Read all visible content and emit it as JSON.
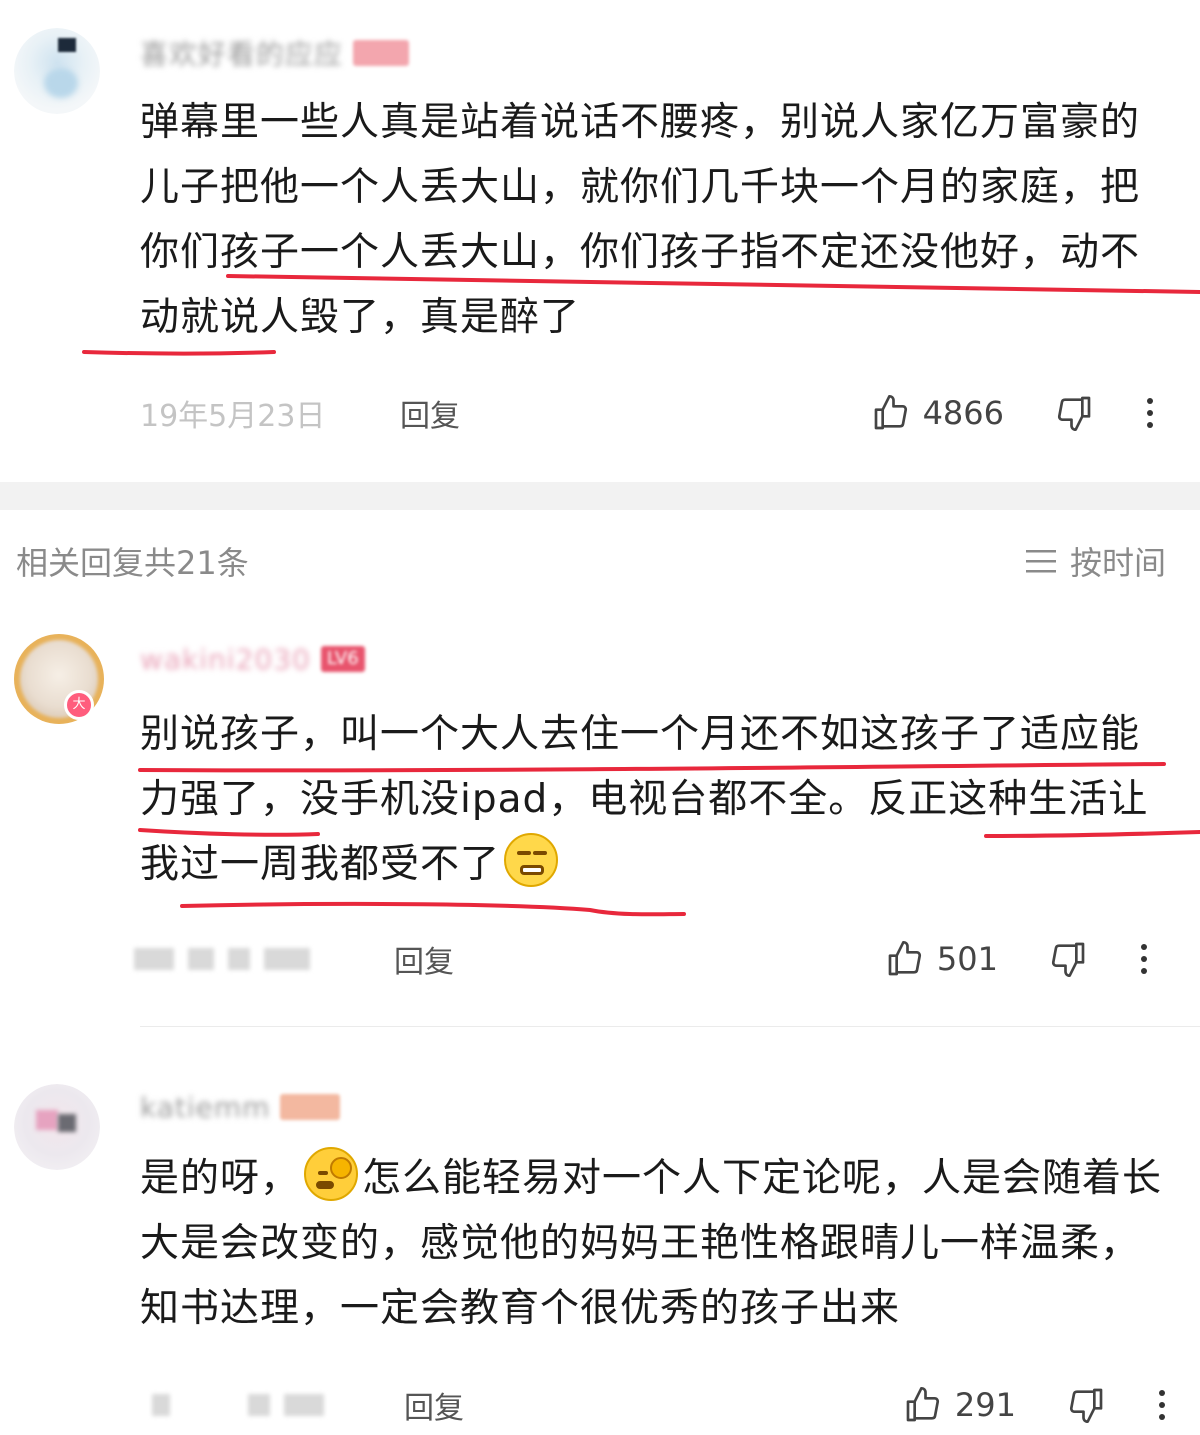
{
  "main_comment": {
    "username": "喜欢好看的应应",
    "text": "弹幕里一些人真是站着说话不腰疼，别说人家亿万富豪的儿子把他一个人丢大山，就你们几千块一个月的家庭，把你们孩子一个人丢大山，你们孩子指不定还没他好，动不动就说人毁了，真是醉了",
    "date": "19年5月23日",
    "reply_label": "回复",
    "likes": "4866"
  },
  "replies_header": {
    "count_label": "相关回复共21条",
    "sort_label": "按时间"
  },
  "replies": [
    {
      "username": "wakini2030",
      "level": "LV6",
      "avatar_badge": "大",
      "text_before_emoji": "别说孩子，叫一个大人去住一个月还不如这孩子了适应能力强了，没手机没ipad，电视台都不全。反正这种生活让我过一周我都受不了",
      "reply_label": "回复",
      "likes": "501"
    },
    {
      "username": "katiemm",
      "text_before_emoji": "是的呀，",
      "text_after_emoji": "怎么能轻易对一个人下定论呢，人是会随着长大是会改变的，感觉他的妈妈王艳性格跟晴儿一样温柔，知书达理，一定会教育个很优秀的孩子出来",
      "reply_label": "回复",
      "likes": "291"
    }
  ],
  "icons": {
    "like": "thumbs-up-icon",
    "dislike": "thumbs-down-icon",
    "more": "more-vertical-icon",
    "sort": "list-icon"
  },
  "colors": {
    "underline": "#e8283c",
    "meta_gray": "#c4c4c4",
    "text": "#1a1a1a"
  }
}
